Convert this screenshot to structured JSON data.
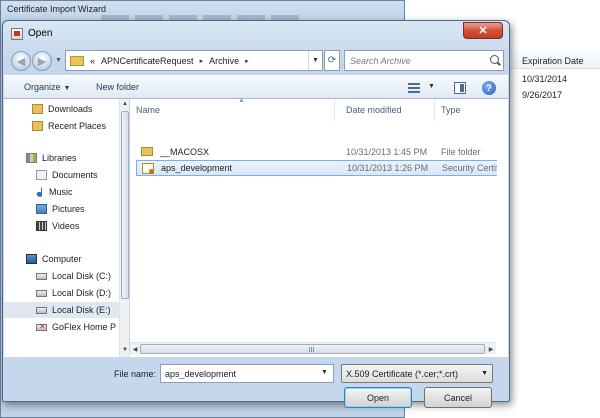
{
  "background": {
    "wizard_title": "Certificate Import Wizard",
    "list_column": "Expiration Date",
    "dates": [
      "10/31/2014",
      "9/26/2017"
    ]
  },
  "dialog": {
    "title": "Open",
    "close_glyph": "✕",
    "address": {
      "overflow": "«",
      "segments": [
        "APNCertificateRequest",
        "Archive"
      ],
      "separator": "▸"
    },
    "search_placeholder": "Search Archive",
    "toolbar": {
      "organize": "Organize",
      "new_folder": "New folder",
      "help": "?"
    },
    "nav_pane": {
      "favorites": [
        "Downloads",
        "Recent Places"
      ],
      "libraries": {
        "label": "Libraries",
        "items": [
          "Documents",
          "Music",
          "Pictures",
          "Videos"
        ]
      },
      "computer": {
        "label": "Computer",
        "items": [
          "Local Disk (C:)",
          "Local Disk (D:)",
          "Local Disk (E:)",
          "GoFlex Home P"
        ]
      }
    },
    "columns": [
      "Name",
      "Date modified",
      "Type"
    ],
    "files": [
      {
        "name": "__MACOSX",
        "date": "10/31/2013 1:45 PM",
        "type": "File folder",
        "icon": "folder-icon"
      },
      {
        "name": "aps_development",
        "date": "10/31/2013 1:26 PM",
        "type": "Security Certificate",
        "icon": "certificate-icon"
      }
    ],
    "file_name_label": "File name:",
    "file_name_value": "aps_development",
    "file_type": "X.509 Certificate (*.cer;*.crt)",
    "open_label": "Open",
    "cancel_label": "Cancel"
  },
  "colors": {
    "accent": "#3c7fb1",
    "selection": "#d7e8fb",
    "close": "#c23b22"
  }
}
